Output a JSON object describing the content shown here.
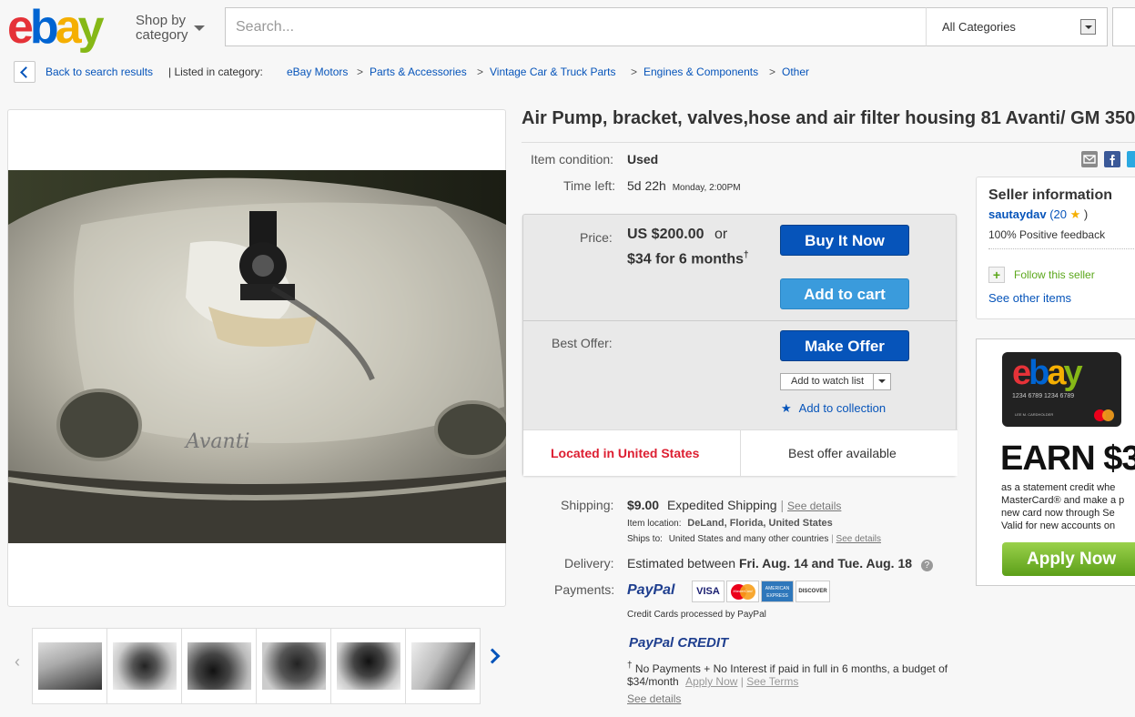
{
  "header": {
    "logo": {
      "e": "e",
      "b": "b",
      "a": "a",
      "y": "y"
    },
    "shop_by_1": "Shop by",
    "shop_by_2": "category",
    "search_placeholder": "Search...",
    "category_select": "All Categories"
  },
  "breadcrumb": {
    "back": "Back to search results",
    "listed_in": "| Listed in category:",
    "items": [
      "eBay Motors",
      "Parts & Accessories",
      "Vintage Car & Truck Parts",
      "Engines & Components",
      "Other"
    ],
    "separator": ">"
  },
  "item": {
    "title": "Air Pump, bracket, valves,hose and air filter housing 81 Avanti/ GM 350",
    "condition_label": "Item condition:",
    "condition": "Used",
    "time_left_label": "Time left:",
    "time_left": "5d 22h",
    "time_left_detail": "Monday, 2:00PM",
    "price_label": "Price:",
    "price": "US $200.00",
    "price_or": "or",
    "financing": "$34 for 6 months",
    "financing_mark": "†",
    "buy_now": "Buy It Now",
    "add_cart": "Add to cart",
    "best_offer_label": "Best Offer:",
    "make_offer": "Make Offer",
    "watch_list": "Add to watch list",
    "add_collection": "Add to collection",
    "located": "Located in United States",
    "best_offer_available": "Best offer available"
  },
  "shipping": {
    "label": "Shipping:",
    "cost": "$9.00",
    "method": "Expedited Shipping",
    "pipe": "|",
    "details": "See details",
    "location_label": "Item location:",
    "location": "DeLand, Florida, United States",
    "ships_to_label": "Ships to:",
    "ships_to": "United States and many other countries",
    "ships_details": "See details"
  },
  "delivery": {
    "label": "Delivery:",
    "text": "Estimated between",
    "dates": "Fri. Aug. 14 and Tue. Aug. 18"
  },
  "payments": {
    "label": "Payments:",
    "paypal": "PayPal",
    "cards": [
      "VISA",
      "MasterCard",
      "AMERICAN EXPRESS",
      "DISCOVER"
    ],
    "processed": "Credit Cards processed by PayPal",
    "credit": "PayPal CREDIT",
    "note_mark": "†",
    "note": "No Payments + No Interest if paid in full in 6 months, a budget of",
    "note2": "$34/month",
    "apply": "Apply Now",
    "pipe": "|",
    "terms": "See Terms",
    "see_details": "See details"
  },
  "seller": {
    "heading": "Seller information",
    "name": "sautaydav",
    "open": "(20",
    "close": ")",
    "feedback": "100% Positive feedback",
    "follow": "Follow this seller",
    "other_items": "See other items"
  },
  "ad": {
    "card_logo": {
      "e": "e",
      "b": "b",
      "a": "a",
      "y": "y"
    },
    "card_number": "1234 6789 1234 6789",
    "card_holder": "LEE M. CARDHOLDER",
    "earn": "EARN $3",
    "line1": "as a statement credit whe",
    "line2": "MasterCard® and make a p",
    "line3": "new card now through Se",
    "line4": "Valid for new accounts on",
    "apply": "Apply Now"
  },
  "colors": {
    "ebay_red": "#e53238",
    "ebay_blue": "#0654ba",
    "ebay_yellow": "#f5af02",
    "ebay_green": "#86b817",
    "located_red": "#dd1e31"
  }
}
